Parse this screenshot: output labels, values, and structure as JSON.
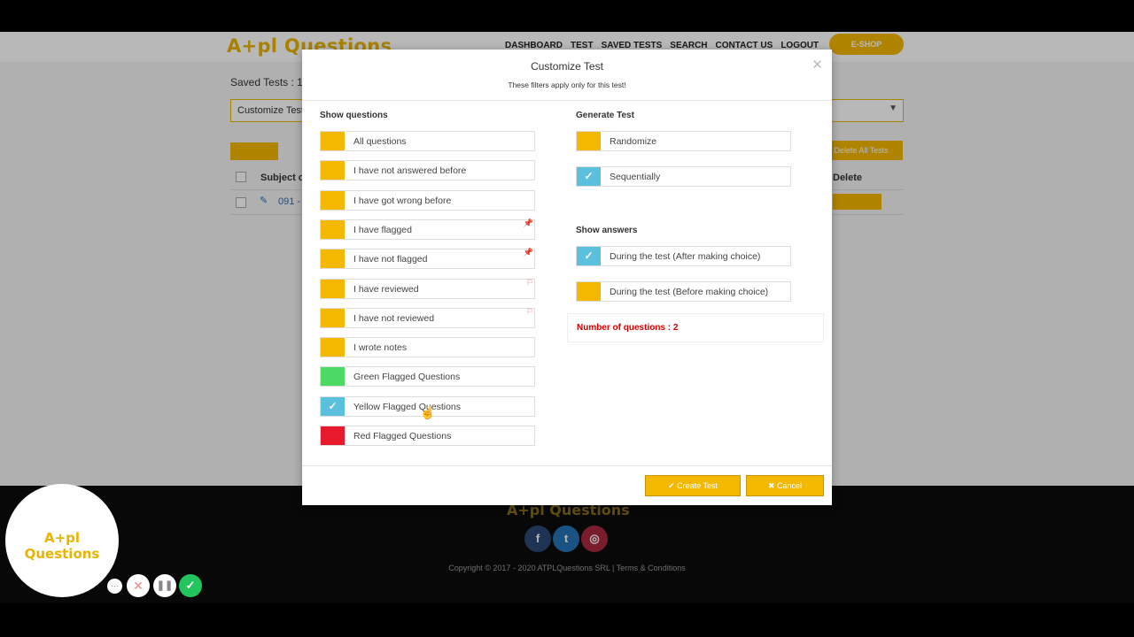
{
  "header": {
    "logo": "A+pl Questions",
    "nav": [
      "DASHBOARD",
      "TEST",
      "SAVED TESTS",
      "SEARCH",
      "CONTACT US",
      "LOGOUT"
    ],
    "eshop_label": "E-SHOP"
  },
  "background": {
    "saved_tests_title": "Saved Tests : 1",
    "customize_select_label": "Customize Test",
    "delete_all_label": "Delete All Tests",
    "table_header_subject": "Subject o",
    "table_header_delete": "Delete",
    "row_subject": "091 -"
  },
  "modal": {
    "title": "Customize Test",
    "subtitle": "These filters apply only for this test!",
    "show_questions_title": "Show questions",
    "show_questions": [
      {
        "label": "All questions",
        "color": "#f5b800",
        "checked": false,
        "marker": ""
      },
      {
        "label": "I have not answered before",
        "color": "#f5b800",
        "checked": false,
        "marker": ""
      },
      {
        "label": "I have got wrong before",
        "color": "#f5b800",
        "checked": false,
        "marker": ""
      },
      {
        "label": "I have flagged",
        "color": "#f5b800",
        "checked": false,
        "marker": "pin"
      },
      {
        "label": "I have not flagged",
        "color": "#f5b800",
        "checked": false,
        "marker": "pin"
      },
      {
        "label": "I have reviewed",
        "color": "#f5b800",
        "checked": false,
        "marker": "flag"
      },
      {
        "label": "I have not reviewed",
        "color": "#f5b800",
        "checked": false,
        "marker": "flag"
      },
      {
        "label": "I wrote notes",
        "color": "#f5b800",
        "checked": false,
        "marker": ""
      },
      {
        "label": "Green Flagged Questions",
        "color": "#4cd964",
        "checked": false,
        "marker": ""
      },
      {
        "label": "Yellow Flagged Questions",
        "color": "#5bc0de",
        "checked": true,
        "marker": ""
      },
      {
        "label": "Red Flagged Questions",
        "color": "#e8192c",
        "checked": false,
        "marker": ""
      }
    ],
    "generate_test_title": "Generate Test",
    "generate_test": [
      {
        "label": "Randomize",
        "color": "#f5b800",
        "checked": false
      },
      {
        "label": "Sequentially",
        "color": "#5bc0de",
        "checked": true
      }
    ],
    "show_answers_title": "Show answers",
    "show_answers": [
      {
        "label": "During the test (After making choice)",
        "color": "#5bc0de",
        "checked": true
      },
      {
        "label": "During the test (Before making choice)",
        "color": "#f5b800",
        "checked": false
      }
    ],
    "number_of_questions_text": "Number of questions : 2",
    "create_button_label": "✔ Create Test",
    "cancel_button_label": "✖ Cancel",
    "close_glyph": "✕"
  },
  "footer": {
    "logo": "A+pl Questions",
    "copyright": "Copyright © 2017 - 2020 ATPLQuestions SRL | Terms & Conditions",
    "social": [
      "f",
      "t",
      "ig"
    ]
  },
  "recorder": {
    "logo": "A+pl Questions"
  }
}
